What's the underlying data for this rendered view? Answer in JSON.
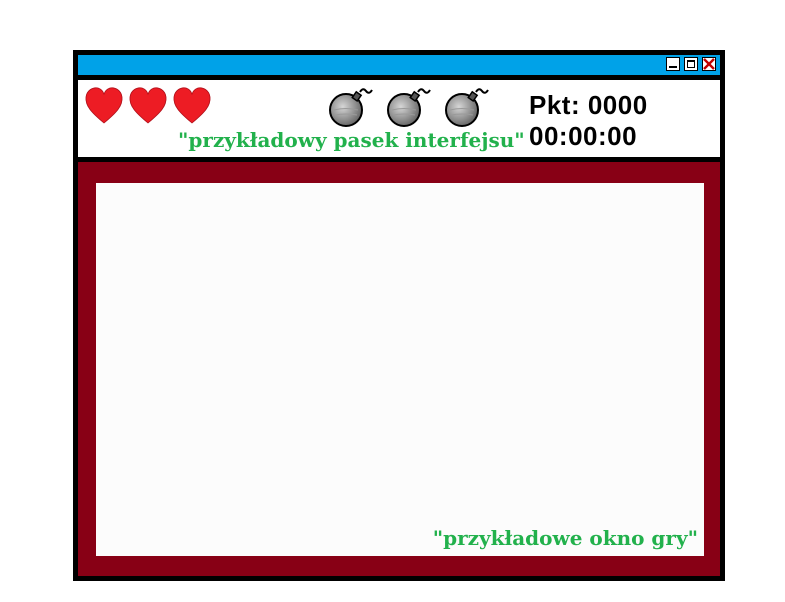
{
  "window": {
    "titlebar_color": "#00a2e8",
    "controls": [
      "minimize-icon",
      "maximize-icon",
      "close-icon"
    ]
  },
  "hud": {
    "lives": {
      "count": 3,
      "icon": "heart-icon",
      "color": "#ed1c24"
    },
    "bombs": {
      "count": 3,
      "icon": "bomb-icon"
    },
    "score_label": "Pkt: 0000",
    "timer": "00:00:00",
    "caption": "\"przykładowy pasek interfejsu\""
  },
  "game": {
    "frame_color": "#880015",
    "caption": "\"przykładowe okno gry\""
  },
  "colors": {
    "caption": "#22b14c"
  }
}
